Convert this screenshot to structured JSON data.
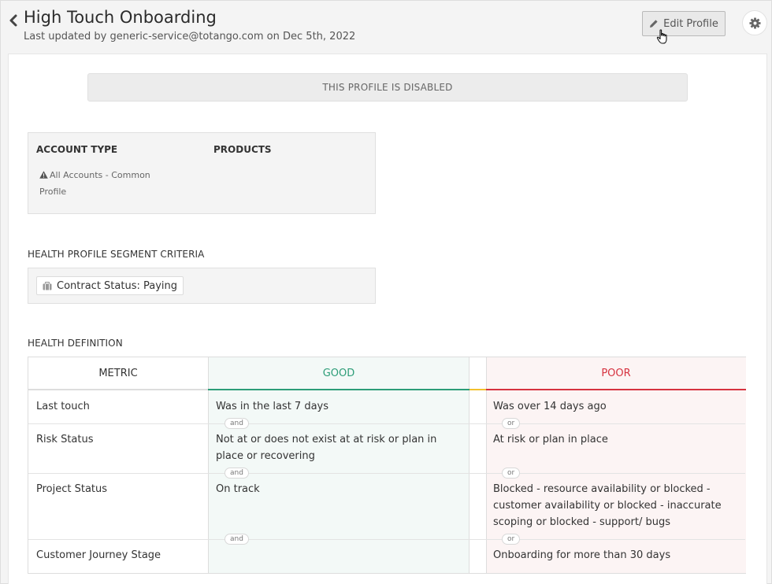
{
  "header": {
    "title": "High Touch Onboarding",
    "subtitle": "Last updated by generic-service@totango.com on Dec 5th, 2022",
    "edit_label": "Edit Profile"
  },
  "banner": "THIS PROFILE IS DISABLED",
  "account": {
    "type_heading": "ACCOUNT TYPE",
    "type_value": "All Accounts - Common Profile",
    "products_heading": "PRODUCTS"
  },
  "segment": {
    "heading": "HEALTH PROFILE SEGMENT CRITERIA",
    "chip": "Contract Status: Paying"
  },
  "health": {
    "heading": "HEALTH DEFINITION",
    "columns": {
      "metric": "METRIC",
      "good": "GOOD",
      "poor": "POOR"
    },
    "rows": [
      {
        "metric": "Last touch",
        "good": "Was in the last 7 days",
        "poor": "Was over 14 days ago"
      },
      {
        "metric": "Risk Status",
        "good": "Not at or does not exist at at risk or plan in place or recovering",
        "poor": "At risk or plan in place"
      },
      {
        "metric": "Project Status",
        "good": "On track",
        "poor": "Blocked - resource availability or blocked - customer availability or blocked - inaccurate scoping or blocked - support/ bugs"
      },
      {
        "metric": "Customer Journey Stage",
        "good": "",
        "poor": "Onboarding for more than 30 days"
      }
    ],
    "good_conjunction": "and",
    "poor_conjunction": "or"
  },
  "colors": {
    "good": "#2d9d78",
    "poor": "#d6323f",
    "neutral": "#f2c12e"
  },
  "icons": [
    "chevron-left-icon",
    "pencil-icon",
    "hand-cursor-icon",
    "gear-icon",
    "warning-icon",
    "briefcase-icon"
  ]
}
